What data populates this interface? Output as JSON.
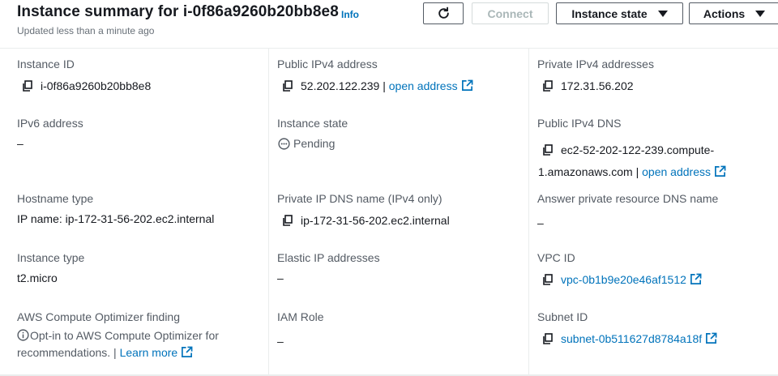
{
  "header": {
    "title": "Instance summary for i-0f86a9260b20bb8e8",
    "info": "Info",
    "updated": "Updated less than a minute ago",
    "buttons": {
      "refresh_icon": "refresh-icon",
      "connect": "Connect",
      "instance_state": "Instance state",
      "actions": "Actions"
    }
  },
  "col1": {
    "instance_id": {
      "label": "Instance ID",
      "value": "i-0f86a9260b20bb8e8"
    },
    "ipv6": {
      "label": "IPv6 address",
      "value": "–"
    },
    "hostname_type": {
      "label": "Hostname type",
      "value": "IP name: ip-172-31-56-202.ec2.internal"
    },
    "instance_type": {
      "label": "Instance type",
      "value": "t2.micro"
    },
    "optimizer": {
      "label": "AWS Compute Optimizer finding",
      "text": "Opt-in to AWS Compute Optimizer for recommendations.",
      "sep": " | ",
      "link": "Learn more"
    }
  },
  "col2": {
    "public_ipv4": {
      "label": "Public IPv4 address",
      "value": "52.202.122.239",
      "sep": " | ",
      "link": "open address"
    },
    "instance_state": {
      "label": "Instance state",
      "value": "Pending"
    },
    "private_dns": {
      "label": "Private IP DNS name (IPv4 only)",
      "value": "ip-172-31-56-202.ec2.internal"
    },
    "elastic_ip": {
      "label": "Elastic IP addresses",
      "value": "–"
    },
    "iam_role": {
      "label": "IAM Role",
      "value": "–"
    }
  },
  "col3": {
    "private_ipv4": {
      "label": "Private IPv4 addresses",
      "value": "172.31.56.202"
    },
    "public_dns": {
      "label": "Public IPv4 DNS",
      "value_line1": "ec2-52-202-122-239.compute-",
      "value_line2": "1.amazonaws.com",
      "sep": " | ",
      "link": "open address"
    },
    "answer_dns": {
      "label": "Answer private resource DNS name",
      "value": "–"
    },
    "vpc_id": {
      "label": "VPC ID",
      "value": "vpc-0b1b9e20e46af1512"
    },
    "subnet_id": {
      "label": "Subnet ID",
      "value": "subnet-0b511627d8784a18f"
    }
  },
  "colors": {
    "link": "#0073bb",
    "text": "#16191f",
    "label": "#545b64",
    "muted": "#687078",
    "border": "#eaeded"
  }
}
